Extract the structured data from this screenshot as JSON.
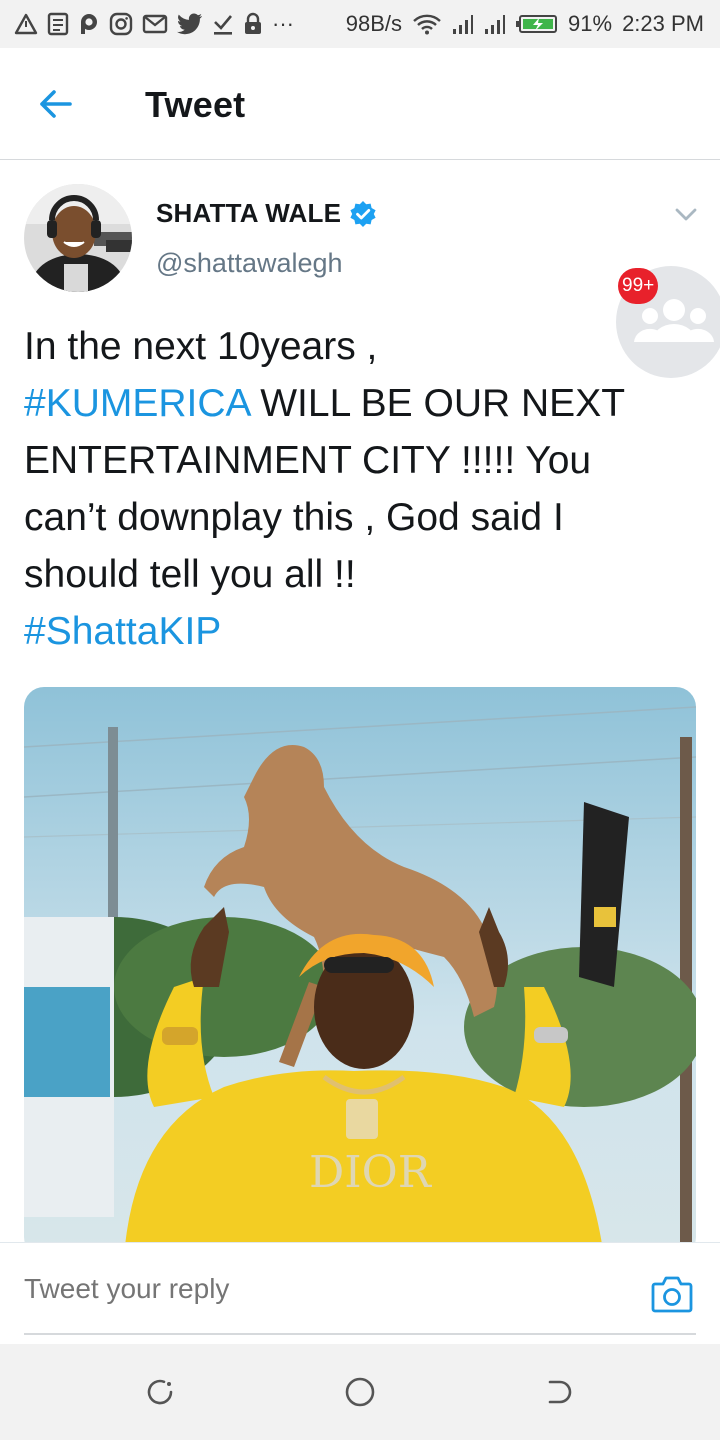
{
  "status_bar": {
    "notification_icons": [
      "alert-icon",
      "document-icon",
      "p-icon",
      "instagram-icon",
      "mail-icon",
      "twitter-icon",
      "download-icon",
      "lock-icon"
    ],
    "more_indicator": "···",
    "network_speed": "98B/s",
    "battery_percent": "91%",
    "time": "2:23 PM"
  },
  "header": {
    "title": "Tweet",
    "back_icon": "back-arrow-icon"
  },
  "tweet": {
    "author_name": "SHATTA WALE",
    "verified": true,
    "handle": "@shattawalegh",
    "text_segments": [
      {
        "text": "In the next 10years ,",
        "type": "text"
      },
      {
        "text": "#KUMERICA",
        "type": "hashtag"
      },
      {
        "text": " WILL BE OUR NEXT ENTERTAINMENT CITY !!!!! You can’t downplay this , God said I should tell you all !!",
        "type": "text"
      },
      {
        "text": "#ShattaKIP",
        "type": "hashtag"
      }
    ],
    "menu_icon": "chevron-down-icon"
  },
  "bubble": {
    "badge": "99+",
    "icon": "group-icon"
  },
  "reply": {
    "placeholder": "Tweet your reply",
    "camera_icon": "camera-icon"
  },
  "nav_bar": {
    "buttons": [
      "recents-icon",
      "home-icon",
      "back-icon"
    ]
  },
  "colors": {
    "accent": "#1b95e0",
    "text_primary": "#14171a",
    "text_secondary": "#657786",
    "badge": "#e8212b",
    "verified": "#1da1f2"
  }
}
